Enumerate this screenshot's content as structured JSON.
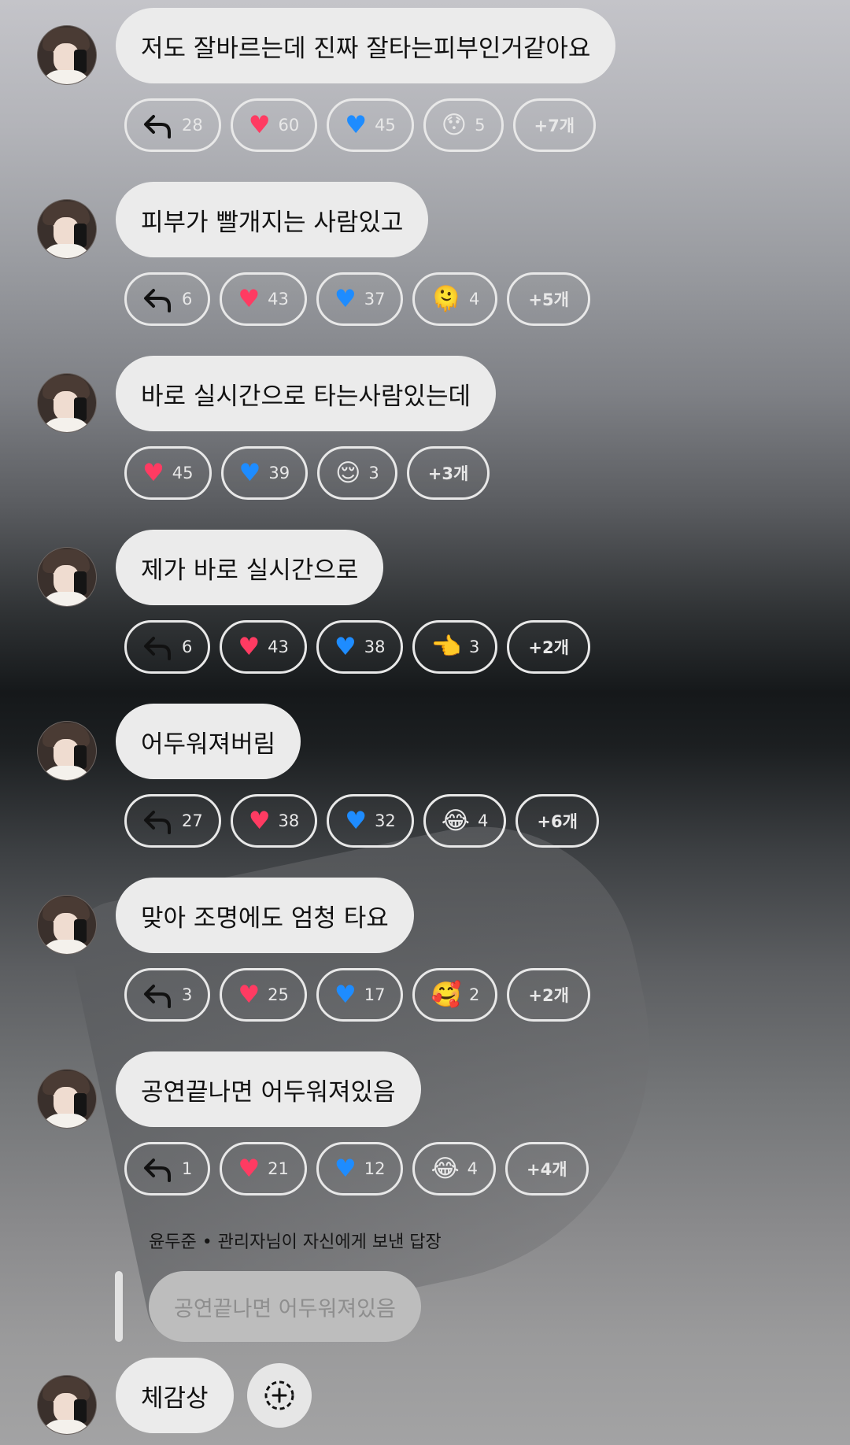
{
  "messages": [
    {
      "text": "저도 잘바르는데 진짜 잘타는피부인거같아요",
      "reactions": [
        {
          "type": "reply",
          "icon": "reply-arrow-icon",
          "count": "28"
        },
        {
          "type": "heart-red",
          "icon": "red-heart-icon",
          "glyph": "♥",
          "count": "60"
        },
        {
          "type": "heart-blue",
          "icon": "blue-heart-icon",
          "glyph": "♥",
          "count": "45"
        },
        {
          "type": "emoji",
          "icon": "surprised-face-icon",
          "glyph": "😯",
          "count": "5"
        }
      ],
      "more": "+7개"
    },
    {
      "text": "피부가 빨개지는 사람있고",
      "reactions": [
        {
          "type": "reply",
          "icon": "reply-arrow-icon",
          "count": "6"
        },
        {
          "type": "heart-red",
          "icon": "red-heart-icon",
          "glyph": "♥",
          "count": "43"
        },
        {
          "type": "heart-blue",
          "icon": "blue-heart-icon",
          "glyph": "♥",
          "count": "37"
        },
        {
          "type": "emoji",
          "icon": "melting-face-icon",
          "glyph": "🫠",
          "count": "4"
        }
      ],
      "more": "+5개"
    },
    {
      "text": "바로 실시간으로 타는사람있는데",
      "reactions": [
        {
          "type": "heart-red",
          "icon": "red-heart-icon",
          "glyph": "♥",
          "count": "45"
        },
        {
          "type": "heart-blue",
          "icon": "blue-heart-icon",
          "glyph": "♥",
          "count": "39"
        },
        {
          "type": "emoji",
          "icon": "relieved-face-icon",
          "glyph": "😌",
          "count": "3"
        }
      ],
      "more": "+3개"
    },
    {
      "text": "제가 바로 실시간으로",
      "reactions": [
        {
          "type": "reply",
          "icon": "reply-arrow-icon",
          "count": "6"
        },
        {
          "type": "heart-red",
          "icon": "red-heart-icon",
          "glyph": "♥",
          "count": "43"
        },
        {
          "type": "heart-blue",
          "icon": "blue-heart-icon",
          "glyph": "♥",
          "count": "38"
        },
        {
          "type": "emoji",
          "icon": "pointing-hand-icon",
          "glyph": "👈",
          "count": "3"
        }
      ],
      "more": "+2개"
    },
    {
      "text": "어두워져버림",
      "reactions": [
        {
          "type": "reply",
          "icon": "reply-arrow-icon",
          "count": "27"
        },
        {
          "type": "heart-red",
          "icon": "red-heart-icon",
          "glyph": "♥",
          "count": "38"
        },
        {
          "type": "heart-blue",
          "icon": "blue-heart-icon",
          "glyph": "♥",
          "count": "32"
        },
        {
          "type": "emoji",
          "icon": "tears-of-joy-icon",
          "glyph": "😂",
          "count": "4"
        }
      ],
      "more": "+6개"
    },
    {
      "text": "맞아 조명에도 엄청 타요",
      "reactions": [
        {
          "type": "reply",
          "icon": "reply-arrow-icon",
          "count": "3"
        },
        {
          "type": "heart-red",
          "icon": "red-heart-icon",
          "glyph": "♥",
          "count": "25"
        },
        {
          "type": "heart-blue",
          "icon": "blue-heart-icon",
          "glyph": "♥",
          "count": "17"
        },
        {
          "type": "emoji",
          "icon": "smiling-hearts-face-icon",
          "glyph": "🥰",
          "count": "2"
        }
      ],
      "more": "+2개"
    },
    {
      "text": "공연끝나면 어두워져있음",
      "reactions": [
        {
          "type": "reply",
          "icon": "reply-arrow-icon",
          "count": "1"
        },
        {
          "type": "heart-red",
          "icon": "red-heart-icon",
          "glyph": "♥",
          "count": "21"
        },
        {
          "type": "heart-blue",
          "icon": "blue-heart-icon",
          "glyph": "♥",
          "count": "12"
        },
        {
          "type": "emoji",
          "icon": "tears-of-joy-icon",
          "glyph": "😂",
          "count": "4"
        }
      ],
      "more": "+4개"
    }
  ],
  "reply_context": {
    "label": "윤두준 • 관리자님이 자신에게 보낸 답장",
    "quoted_text": "공연끝나면 어두워져있음"
  },
  "last_message": {
    "text": "체감상"
  },
  "colors": {
    "bubble": "#ebebeb",
    "chip_border": "#e8e8e8",
    "heart_red": "#ff3b62",
    "heart_blue": "#1e8cff"
  }
}
